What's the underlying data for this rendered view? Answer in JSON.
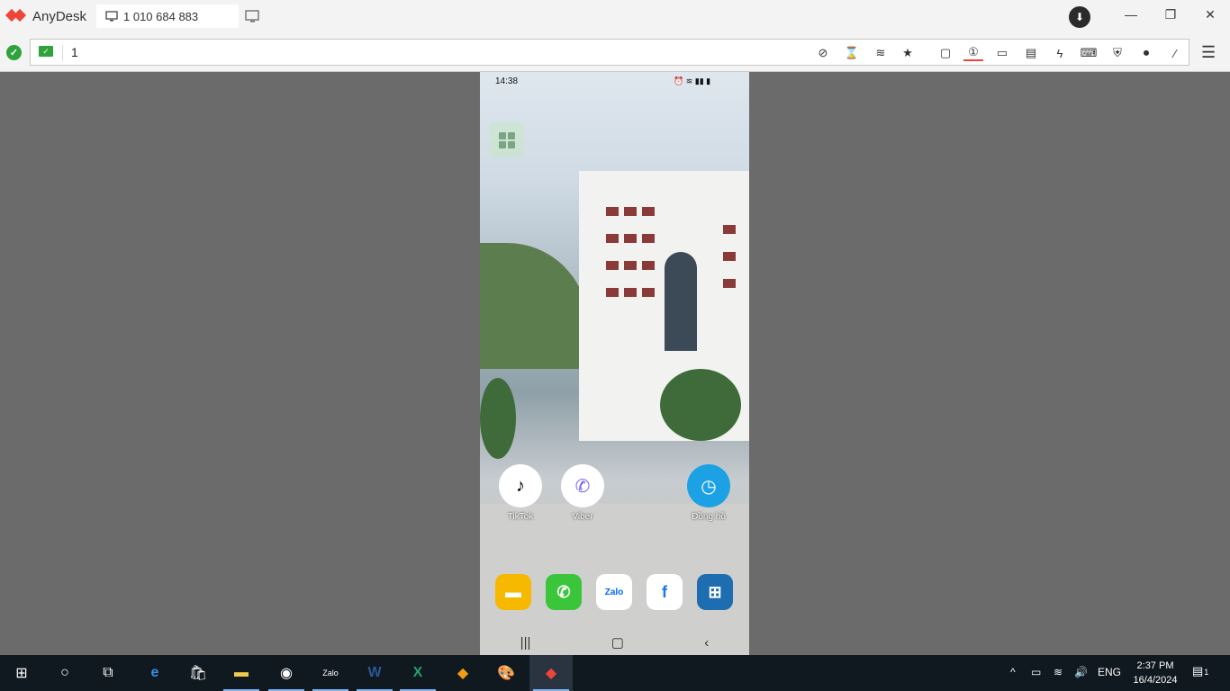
{
  "app": {
    "name": "AnyDesk"
  },
  "tab": {
    "label": "1 010 684 883"
  },
  "address": {
    "value": "1"
  },
  "phone": {
    "status_time": "14:38",
    "apps": [
      {
        "label": "TikTok",
        "icon": "tiktok-icon"
      },
      {
        "label": "Viber",
        "icon": "viber-icon"
      },
      {
        "label": "Đồng hồ",
        "icon": "clock-icon"
      }
    ],
    "dock": [
      {
        "name": "messages",
        "icon": "message-icon",
        "color": "#f6b900"
      },
      {
        "name": "phone",
        "icon": "phone-icon",
        "color": "#3bc53b"
      },
      {
        "name": "zalo",
        "label": "Zalo",
        "color": "#ffffff"
      },
      {
        "name": "facebook",
        "icon": "facebook-icon",
        "color": "#ffffff"
      },
      {
        "name": "app-grid",
        "icon": "windows-grid-icon",
        "color": "#1d6db0"
      }
    ]
  },
  "taskbar": {
    "zalo_label": "Zalo",
    "lang": "ENG",
    "time": "2:37 PM",
    "date": "16/4/2024",
    "notification_count": "1"
  },
  "colors": {
    "accent": "#ef443b",
    "connected": "#2fa23b",
    "taskbar": "#101820"
  }
}
